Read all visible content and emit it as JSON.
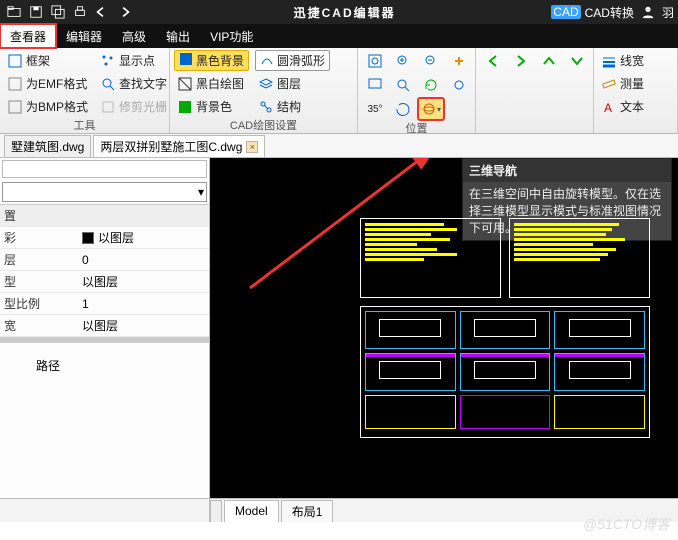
{
  "title": "迅捷CAD编辑器",
  "top_right": {
    "badge": "CAD",
    "convert": "CAD转换",
    "user": "羽"
  },
  "menu": {
    "viewer": "查看器",
    "editor": "编辑器",
    "advanced": "高级",
    "output": "输出",
    "vip": "VIP功能"
  },
  "ribbon": {
    "group1_label": "工具",
    "g1": {
      "frame": "框架",
      "emf": "为EMF格式",
      "bmp": "为BMP格式",
      "show_points": "显示点",
      "find_text": "查找文字",
      "trim": "修剪光栅"
    },
    "group2_label": "CAD绘图设置",
    "g2": {
      "black_bg": "黑色背景",
      "smooth": "圆滑弧形",
      "bw": "黑白绘图",
      "layers": "图层",
      "bgcolor": "背景色",
      "structure": "结构"
    },
    "group3_label": "位置",
    "g3": {
      "deg": "35°"
    },
    "group4_label": "",
    "g4": {
      "linew": "线宽",
      "measure": "测量",
      "text": "文本"
    }
  },
  "tabs": {
    "t1": "墅建筑图.dwg",
    "t2": "两层双拼别墅施工图C.dwg"
  },
  "props": {
    "head": "置",
    "rows": [
      {
        "k": "彩",
        "v": "以图层",
        "swatch": true
      },
      {
        "k": "层",
        "v": "0"
      },
      {
        "k": "型",
        "v": "以图层"
      },
      {
        "k": "型比例",
        "v": "1"
      },
      {
        "k": "宽",
        "v": "以图层"
      }
    ],
    "path": "路径"
  },
  "tooltip": {
    "title": "三维导航",
    "body": "在三维空间中自由旋转模型。仅在选择三维模型显示模式与标准视图情况下可用。"
  },
  "bottom": {
    "model": "Model",
    "layout": "布局1"
  },
  "watermark": "@51CTO博客"
}
